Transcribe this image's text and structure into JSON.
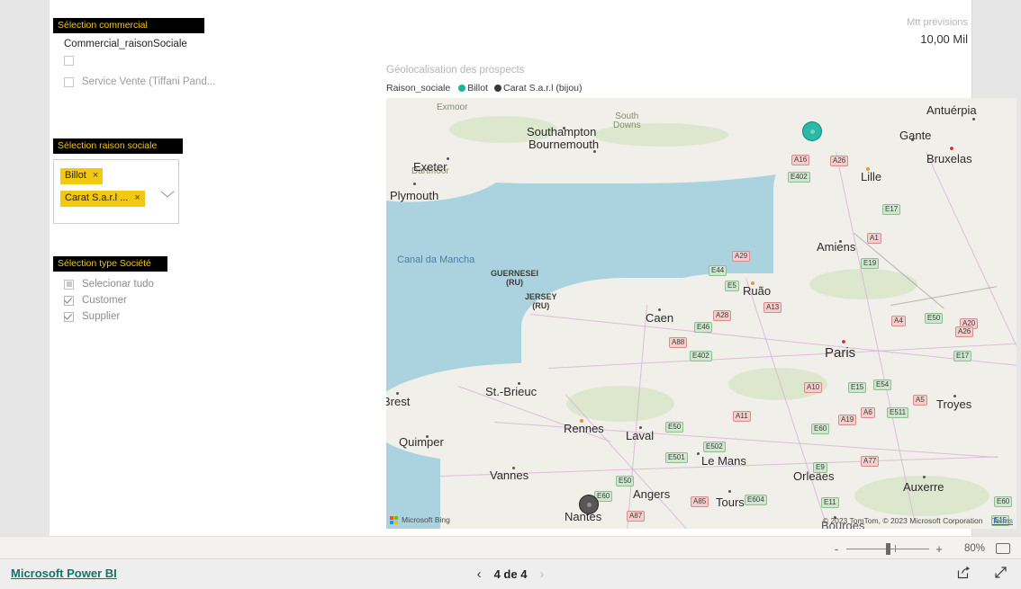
{
  "slicers": {
    "commercial": {
      "title": "Sélection commercial",
      "subtitle": "Commercial_raisonSociale",
      "items": [
        {
          "label": "",
          "checked": false
        },
        {
          "label": "Service Vente (Tiffani Pand...",
          "checked": false
        }
      ]
    },
    "raison_sociale": {
      "title": "Sélection raison sociale",
      "chips": [
        {
          "label": "Billot",
          "remove": "×"
        },
        {
          "label": "Carat S.a.r.l ...",
          "remove": "×"
        }
      ],
      "chevron_icon": "chevron-down-icon"
    },
    "type_societe": {
      "title": "Sélection type Société",
      "items": [
        {
          "label": "Selecionar tudo",
          "state": "partial"
        },
        {
          "label": "Customer",
          "state": "checked"
        },
        {
          "label": "Supplier",
          "state": "checked"
        }
      ]
    }
  },
  "kpi": {
    "label": "Mtt prévisions",
    "value": "10,00 Mil"
  },
  "map_visual": {
    "title": "Géolocalisation des prospects",
    "legend_title": "Raison_sociale",
    "legend": [
      {
        "label": "Billot",
        "color": "#1ab3a0"
      },
      {
        "label": "Carat S.a.r.l (bijou)",
        "color": "#343a3c"
      }
    ],
    "provider": "Microsoft Bing",
    "attribution": "© 2023 TomTom, © 2023 Microsoft Corporation",
    "terms_label": "Terms",
    "sea_labels": [
      {
        "text": "Canal da Mancha"
      }
    ],
    "islands": [
      {
        "text": "GUERNESEI",
        "sub": "(RU)"
      },
      {
        "text": "JERSEY",
        "sub": "(RU)"
      }
    ],
    "cities": [
      "Southampton",
      "Bournemouth",
      "Exeter",
      "Plymouth",
      "Antuérpia",
      "Gante",
      "Bruxelas",
      "Lille",
      "Amiens",
      "Ruão",
      "Caen",
      "Paris",
      "Troyes",
      "St.-Brieuc",
      "Brest",
      "Rennes",
      "Laval",
      "Le Mans",
      "Orleães",
      "Auxerre",
      "Quimper",
      "Vannes",
      "Angers",
      "Tours",
      "Nantes",
      "Bourges"
    ],
    "areas": [
      "Exmoor",
      "South Downs",
      "Dartmoor"
    ],
    "roads": [
      "A16",
      "A26",
      "E402",
      "E17",
      "A1",
      "E19",
      "E44",
      "A29",
      "E5",
      "E46",
      "A13",
      "A28",
      "A88",
      "E402",
      "A4",
      "E50",
      "A20",
      "E17",
      "A10",
      "E15",
      "E54",
      "A5",
      "E511",
      "A6",
      "A11",
      "E50",
      "E60",
      "A19",
      "E9",
      "A77",
      "E501",
      "E502",
      "E50",
      "E60",
      "A85",
      "E604",
      "A87",
      "E11",
      "E60",
      "E15",
      "A26"
    ],
    "data_points": [
      {
        "series": "Billot",
        "color": "#1ab3a0",
        "size": 22
      },
      {
        "series": "Carat S.a.r.l (bijou)",
        "color": "#3c3c3c",
        "size": 22
      }
    ]
  },
  "statusbar": {
    "zoom_out_label": "-",
    "zoom_in_label": "+",
    "zoom_percent": "80%",
    "fit_icon": "fit-to-page-icon"
  },
  "footer": {
    "brand": "Microsoft Power BI",
    "prev_icon": "chevron-left-icon",
    "next_icon": "chevron-right-icon",
    "page_text": "4 de 4",
    "share_icon": "share-icon",
    "fullscreen_icon": "fullscreen-icon"
  }
}
